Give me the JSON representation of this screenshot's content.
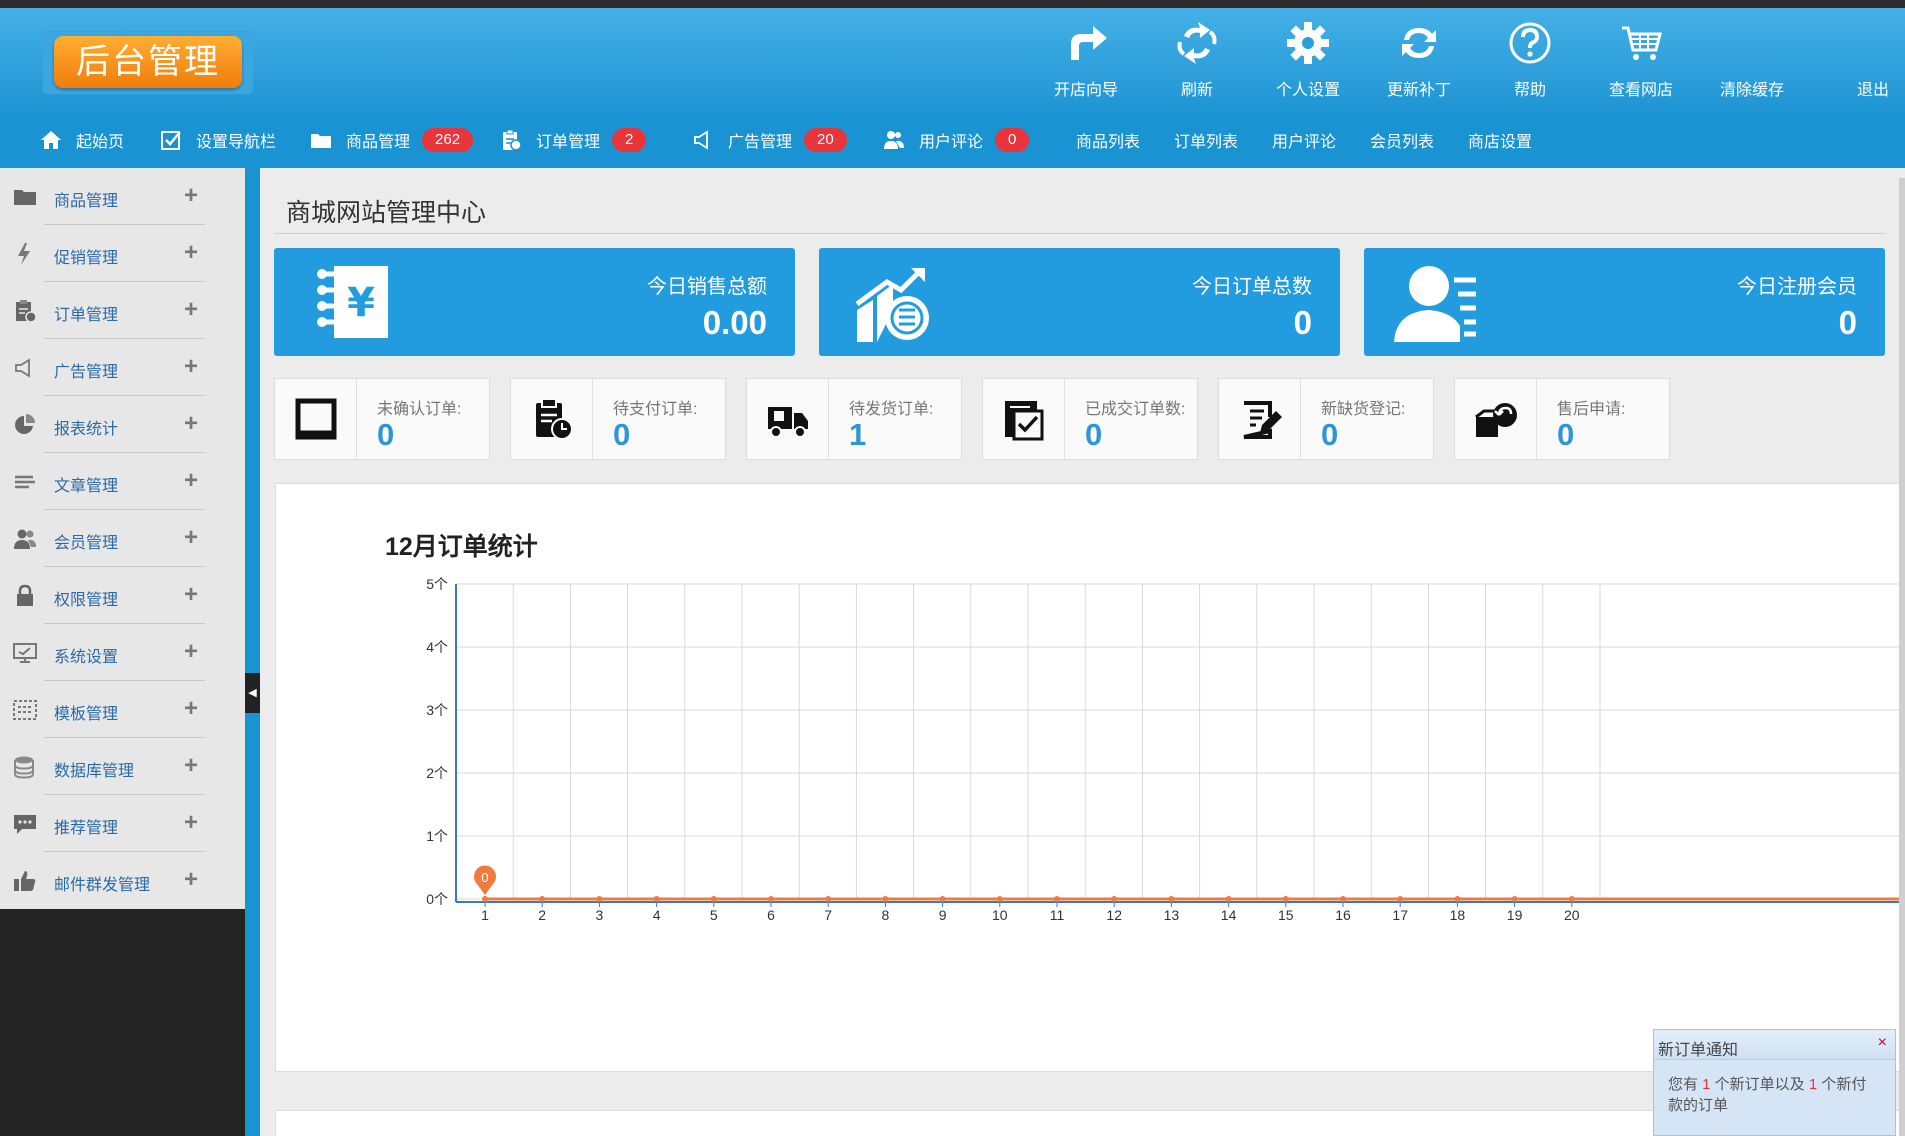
{
  "logo": {
    "text": "后台管理"
  },
  "colors": {
    "header": "#2a9fdc",
    "accent": "#229cde",
    "badge": "#e8343a",
    "logo": "#f39a1f",
    "line": "#f07b3f"
  },
  "toolbar": [
    {
      "label": "开店向导",
      "icon": "redo-arrow-icon"
    },
    {
      "label": "刷新",
      "icon": "refresh-icon"
    },
    {
      "label": "个人设置",
      "icon": "gear-icon"
    },
    {
      "label": "更新补丁",
      "icon": "sync-icon"
    },
    {
      "label": "帮助",
      "icon": "help-icon"
    },
    {
      "label": "查看网店",
      "icon": "cart-icon"
    },
    {
      "label": "清除缓存",
      "icon": ""
    },
    {
      "label": "退出",
      "icon": ""
    }
  ],
  "nav": [
    {
      "label": "起始页",
      "icon": "home-icon"
    },
    {
      "label": "设置导航栏",
      "icon": "checkbox-icon"
    },
    {
      "label": "商品管理",
      "icon": "folder-icon",
      "badge": "262"
    },
    {
      "label": "订单管理",
      "icon": "clipboard-icon",
      "badge": "2"
    },
    {
      "label": "广告管理",
      "icon": "megaphone-icon",
      "badge": "20"
    },
    {
      "label": "用户评论",
      "icon": "users-icon",
      "badge": "0"
    },
    {
      "label": "商品列表"
    },
    {
      "label": "订单列表"
    },
    {
      "label": "用户评论"
    },
    {
      "label": "会员列表"
    },
    {
      "label": "商店设置"
    }
  ],
  "sidebar": [
    {
      "label": "商品管理",
      "icon": "folder-icon"
    },
    {
      "label": "促销管理",
      "icon": "lightning-icon"
    },
    {
      "label": "订单管理",
      "icon": "clipboard-icon"
    },
    {
      "label": "广告管理",
      "icon": "megaphone-icon"
    },
    {
      "label": "报表统计",
      "icon": "pie-chart-icon"
    },
    {
      "label": "文章管理",
      "icon": "text-lines-icon"
    },
    {
      "label": "会员管理",
      "icon": "users-icon"
    },
    {
      "label": "权限管理",
      "icon": "lock-icon"
    },
    {
      "label": "系统设置",
      "icon": "monitor-icon"
    },
    {
      "label": "模板管理",
      "icon": "template-grid-icon"
    },
    {
      "label": "数据库管理",
      "icon": "database-icon"
    },
    {
      "label": "推荐管理",
      "icon": "chat-icon"
    },
    {
      "label": "邮件群发管理",
      "icon": "thumbs-up-icon"
    }
  ],
  "sidebar_plus": "+",
  "page": {
    "title": "商城网站管理中心"
  },
  "stats": [
    {
      "label": "今日销售总额",
      "value": "0.00",
      "icon": "yen-notebook-icon"
    },
    {
      "label": "今日订单总数",
      "value": "0",
      "icon": "growth-chart-icon"
    },
    {
      "label": "今日注册会员",
      "value": "0",
      "icon": "member-icon"
    }
  ],
  "order_stats": [
    {
      "label": "未确认订单:",
      "value": "0",
      "icon": "square-frame-icon"
    },
    {
      "label": "待支付订单:",
      "value": "0",
      "icon": "clipboard-clock-icon"
    },
    {
      "label": "待发货订单:",
      "value": "1",
      "icon": "truck-icon"
    },
    {
      "label": "已成交订单数:",
      "value": "0",
      "icon": "checked-doc-icon"
    },
    {
      "label": "新缺货登记:",
      "value": "0",
      "icon": "edit-doc-icon"
    },
    {
      "label": "售后申请:",
      "value": "0",
      "icon": "return-box-icon"
    }
  ],
  "chart_data": {
    "type": "line",
    "title": "12月订单统计",
    "x": [
      1,
      2,
      3,
      4,
      5,
      6,
      7,
      8,
      9,
      10,
      11,
      12,
      13,
      14,
      15,
      16,
      17,
      18,
      19,
      20
    ],
    "series": [
      {
        "values": [
          0,
          0,
          0,
          0,
          0,
          0,
          0,
          0,
          0,
          0,
          0,
          0,
          0,
          0,
          0,
          0,
          0,
          0,
          0,
          0
        ]
      }
    ],
    "ylim": [
      0,
      5
    ],
    "ytick_labels": [
      "0个",
      "1个",
      "2个",
      "3个",
      "4个",
      "5个"
    ],
    "grid": true,
    "annotations": [
      {
        "x": 1,
        "label": "0"
      }
    ]
  },
  "notice": {
    "title": "新订单通知",
    "close": "×",
    "t1": "您有 ",
    "n1": "1",
    "t2": " 个新订单以及 ",
    "n2": "1",
    "t3": " 个新付款的订单"
  }
}
